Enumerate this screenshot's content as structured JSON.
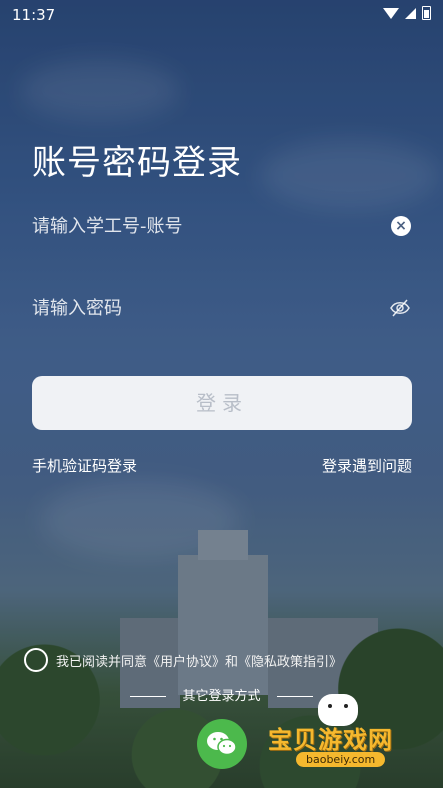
{
  "status_bar": {
    "time": "11:37"
  },
  "title": "账号密码登录",
  "account_field": {
    "placeholder": "请输入学工号-账号"
  },
  "password_field": {
    "placeholder": "请输入密码"
  },
  "login_button": {
    "label": "登录"
  },
  "links": {
    "sms_login": "手机验证码登录",
    "login_help": "登录遇到问题"
  },
  "agreement": {
    "prefix": "我已阅读并同意",
    "user_agreement": "《用户协议》",
    "and": "和",
    "privacy_policy": "《隐私政策指引》"
  },
  "other_login": {
    "label": "其它登录方式"
  },
  "watermark": {
    "text": "宝贝游戏网",
    "url": "baobeiy.com"
  },
  "colors": {
    "wechat_green": "#4cb94c",
    "watermark_yellow": "#f5b82e"
  }
}
